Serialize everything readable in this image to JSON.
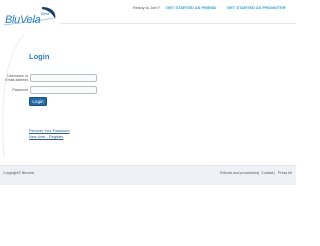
{
  "brand": {
    "logo_word": "BluVela",
    "logo_tag": "Beta",
    "accent": "#2b7fc0",
    "link_color": "#2a9fd6"
  },
  "topnav": {
    "prompt": "Ready to Join?",
    "friend": "GET STARTED AS FRIEND",
    "promoter": "GET STARTED AS PROMOTER"
  },
  "login": {
    "title": "Login",
    "username_label": "Username or Email address",
    "password_label": "Password",
    "username_value": "",
    "password_value": "",
    "button": "Login",
    "recover_link": "Recover Your Password",
    "register_link": "New User - Register"
  },
  "footer": {
    "copyright": "Copyright© Bluvela",
    "policies": "Policies and procedures",
    "separator": "|",
    "contact": "Contact",
    "press": "Press kit"
  }
}
